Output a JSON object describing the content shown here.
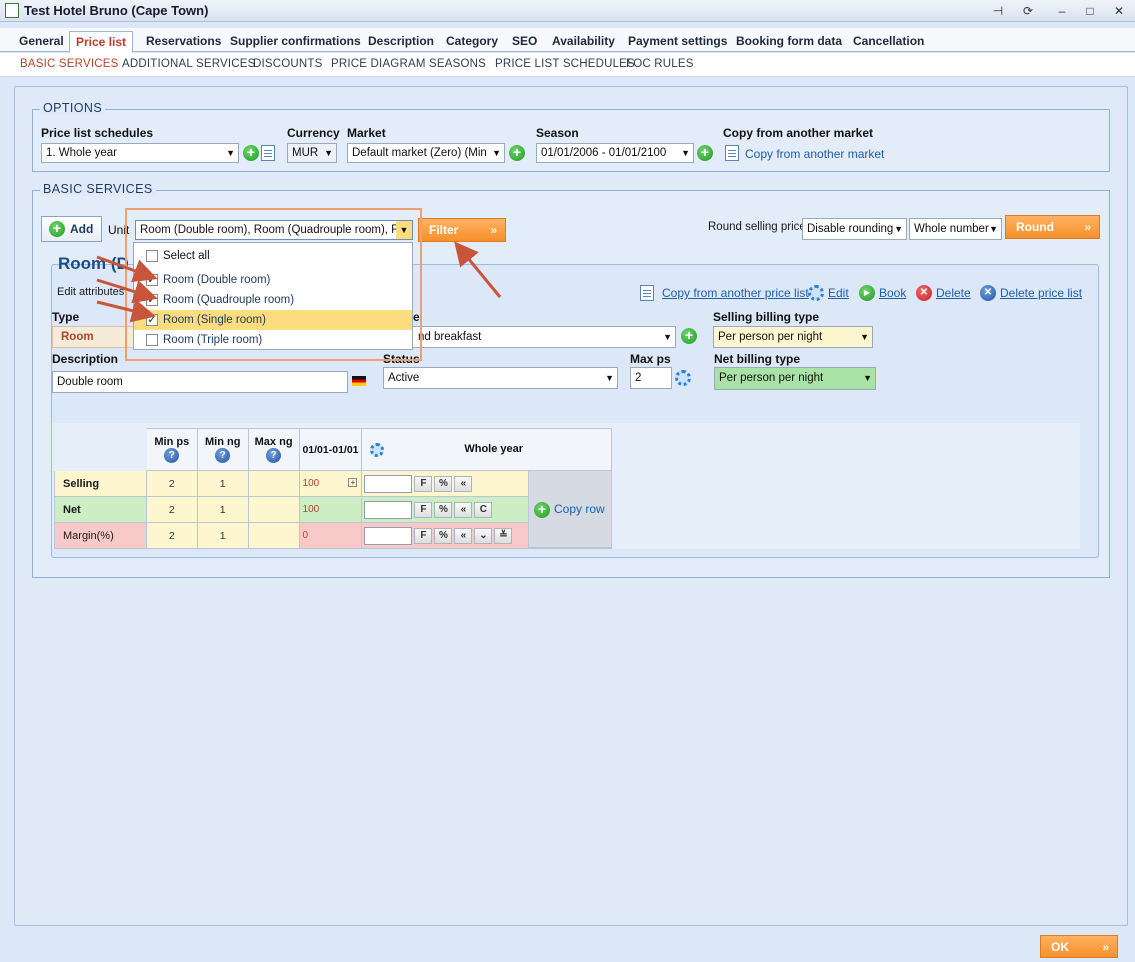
{
  "window": {
    "title": "Test Hotel Bruno (Cape Town)"
  },
  "tabs": [
    "General",
    "Price list",
    "Reservations",
    "Supplier confirmations",
    "Description",
    "Category",
    "SEO",
    "Availability",
    "Payment settings",
    "Booking form data",
    "Cancellation"
  ],
  "subtabs": [
    "BASIC SERVICES",
    "ADDITIONAL SERVICES",
    "DISCOUNTS",
    "PRICE DIAGRAM",
    "SEASONS",
    "PRICE LIST SCHEDULES",
    "FOC RULES"
  ],
  "options": {
    "legend": "OPTIONS",
    "schedules_label": "Price list schedules",
    "schedules_value": "1. Whole year",
    "currency_label": "Currency",
    "currency_value": "MUR",
    "market_label": "Market",
    "market_value": "Default market (Zero) (Min",
    "season_label": "Season",
    "season_value": "01/01/2006 - 01/01/2100",
    "copy_label": "Copy from another market",
    "copy_link": "Copy from another market"
  },
  "basic": {
    "legend": "BASIC SERVICES",
    "add_label": "Add",
    "unit_label": "Unit",
    "unit_value": "Room (Double room), Room (Quadrouple room), Ro",
    "filter_label": "Filter",
    "round_label": "Round selling price",
    "rounding_value": "Disable rounding",
    "number_value": "Whole number",
    "round_button": "Round"
  },
  "dropdown": {
    "items": [
      {
        "label": "Select all",
        "checked": false
      },
      {
        "label": "Room (Double room)",
        "checked": true
      },
      {
        "label": "Room (Quadrouple room)",
        "checked": true
      },
      {
        "label": "Room (Single room)",
        "checked": true
      },
      {
        "label": "Room (Triple room)",
        "checked": false
      }
    ]
  },
  "service": {
    "title_fragment": "Room (D",
    "edit_attributes": "Edit attributes",
    "copy_price_list": "Copy from another price list",
    "edit": "Edit",
    "book": "Book",
    "delete": "Delete",
    "delete_price_list": "Delete price list",
    "type_label": "Type",
    "type_value": "Room",
    "board_label_fragment": "e",
    "board_value": "nd breakfast",
    "selling_billing_label": "Selling billing type",
    "selling_billing_value": "Per person per night",
    "description_label": "Description",
    "description_value": "Double room",
    "status_label": "Status",
    "status_value": "Active",
    "maxps_label": "Max ps",
    "maxps_value": "2",
    "net_billing_label": "Net billing type",
    "net_billing_value": "Per person per night"
  },
  "grid": {
    "headers": [
      "Min ps",
      "Min ng",
      "Max ng",
      "01/01-01/01",
      "Whole year"
    ],
    "rows": [
      {
        "label": "Selling",
        "minps": "2",
        "minng": "1",
        "maxng": "",
        "price": "100"
      },
      {
        "label": "Net",
        "minps": "2",
        "minng": "1",
        "maxng": "",
        "price": "100"
      },
      {
        "label": "Margin(%)",
        "minps": "2",
        "minng": "1",
        "maxng": "",
        "price": "0"
      }
    ],
    "btn_f": "F",
    "btn_pct": "%",
    "btn_back": "«",
    "btn_c": "C",
    "copy_row": "Copy row"
  },
  "footer": {
    "ok": "OK"
  },
  "colors": {
    "accent_orange": "#f6902b",
    "link_blue": "#1f5ea8",
    "active_tab": "#c0392b"
  }
}
